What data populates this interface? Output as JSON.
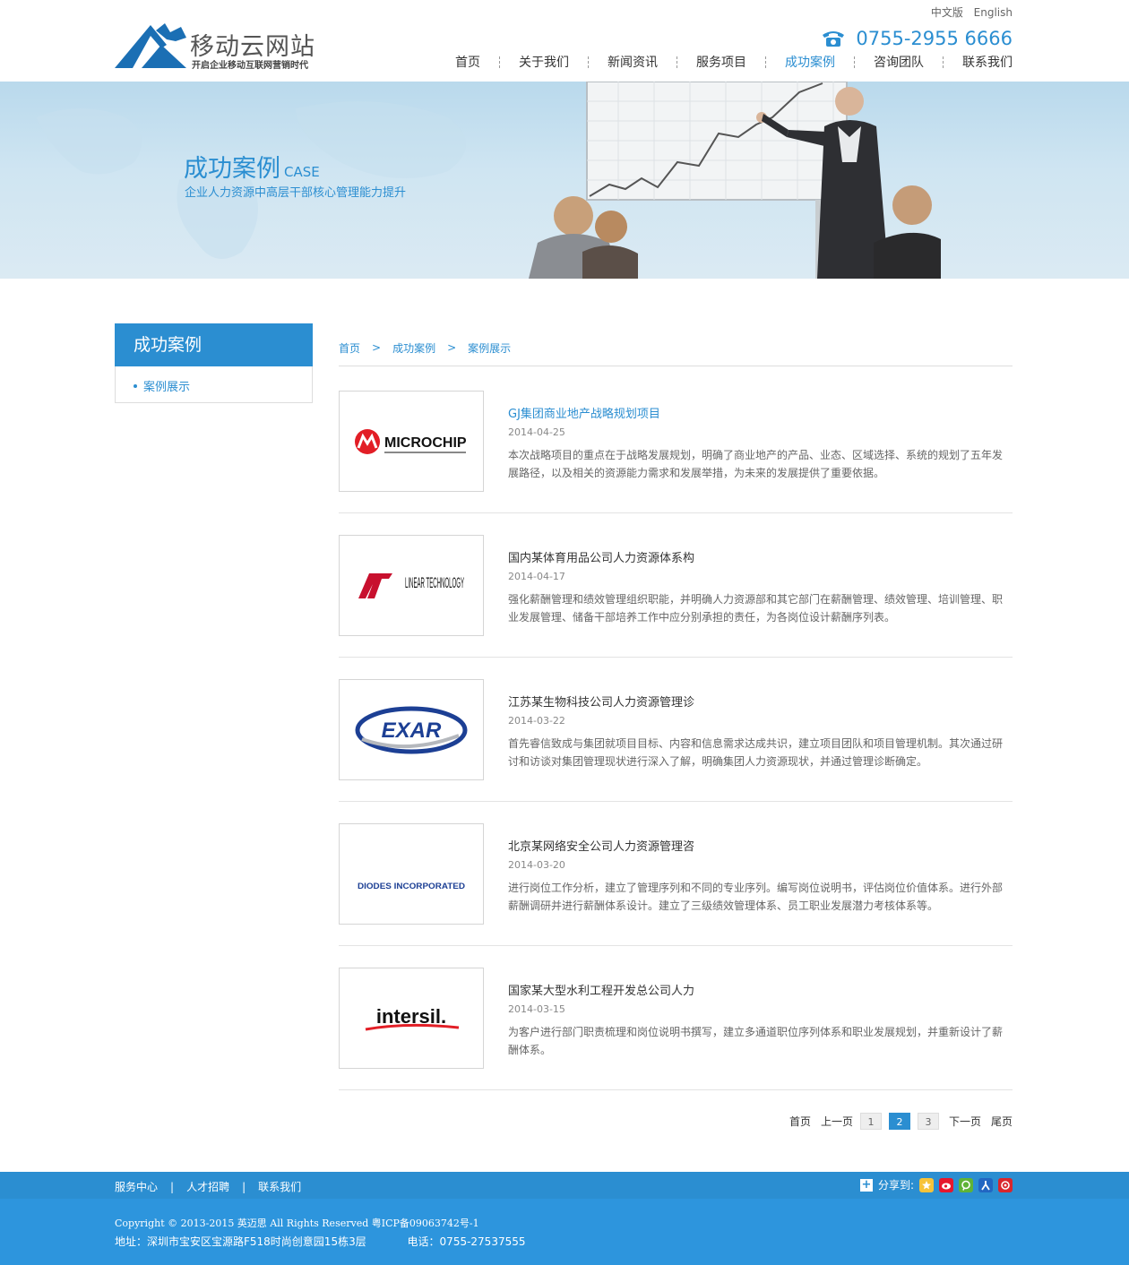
{
  "header": {
    "logo_title": "移动云网站",
    "logo_subtitle": "开启企业移动互联网营销时代",
    "lang_cn": "中文版",
    "lang_en": "English",
    "phone": "0755-2955 6666",
    "nav": [
      {
        "label": "首页"
      },
      {
        "label": "关于我们"
      },
      {
        "label": "新闻资讯"
      },
      {
        "label": "服务项目"
      },
      {
        "label": "成功案例"
      },
      {
        "label": "咨询团队"
      },
      {
        "label": "联系我们"
      }
    ],
    "active_nav": "成功案例"
  },
  "banner": {
    "title": "成功案例",
    "title_en": "CASE",
    "subtitle": "企业人力资源中高层干部核心管理能力提升"
  },
  "sidebar": {
    "heading": "成功案例",
    "items": [
      {
        "label": "案例展示"
      }
    ]
  },
  "breadcrumb": [
    "首页",
    "成功案例",
    "案例展示"
  ],
  "cases": [
    {
      "logo": "MICROCHIP",
      "title": "GJ集团商业地产战略规划项目",
      "date": "2014-04-25",
      "desc": "本次战略项目的重点在于战略发展规划，明确了商业地产的产品、业态、区域选择、系统的规划了五年发展路径，以及相关的资源能力需求和发展举措，为未来的发展提供了重要依据。"
    },
    {
      "logo": "LINEAR TECHNOLOGY",
      "title": "国内某体育用品公司人力资源体系构",
      "date": "2014-04-17",
      "desc": "强化薪酬管理和绩效管理组织职能，并明确人力资源部和其它部门在薪酬管理、绩效管理、培训管理、职业发展管理、储备干部培养工作中应分别承担的责任，为各岗位设计薪酬序列表。"
    },
    {
      "logo": "EXAR",
      "title": "江苏某生物科技公司人力资源管理诊",
      "date": "2014-03-22",
      "desc": "首先睿信致成与集团就项目目标、内容和信息需求达成共识，建立项目团队和项目管理机制。其次通过研讨和访谈对集团管理现状进行深入了解，明确集团人力资源现状，并通过管理诊断确定。"
    },
    {
      "logo": "DIODES INCORPORATED",
      "title": "北京某网络安全公司人力资源管理咨",
      "date": "2014-03-20",
      "desc": "进行岗位工作分析，建立了管理序列和不同的专业序列。编写岗位说明书，评估岗位价值体系。进行外部薪酬调研并进行薪酬体系设计。建立了三级绩效管理体系、员工职业发展潜力考核体系等。"
    },
    {
      "logo": "intersil.",
      "title": "国家某大型水利工程开发总公司人力",
      "date": "2014-03-15",
      "desc": "为客户进行部门职责梳理和岗位说明书撰写，建立多通道职位序列体系和职业发展规划，并重新设计了薪酬体系。"
    }
  ],
  "pager": {
    "first": "首页",
    "prev": "上一页",
    "pages": [
      "1",
      "2",
      "3"
    ],
    "current": "2",
    "next": "下一页",
    "last": "尾页"
  },
  "footer": {
    "links": [
      "服务中心",
      "人才招聘",
      "联系我们"
    ],
    "share_label": "分享到:",
    "copyright": "Copyright © 2013-2015 英迈思 All Rights Reserved 粤ICP备09063742号-1",
    "address": "地址：深圳市宝安区宝源路F518时尚创意园15栋3层",
    "tel": "电话：0755-27537555"
  },
  "colors": {
    "accent": "#2b8ed1",
    "footer_bar": "#2b8ed1",
    "footer_main": "#2d95dd"
  }
}
